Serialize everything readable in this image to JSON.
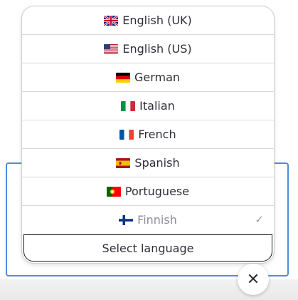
{
  "languages": [
    {
      "label": "English (UK)",
      "flag": "uk-flag-icon",
      "disabled": false,
      "checked": false
    },
    {
      "label": "English (US)",
      "flag": "us-flag-icon",
      "disabled": false,
      "checked": false
    },
    {
      "label": "German",
      "flag": "germany-flag-icon",
      "disabled": false,
      "checked": false
    },
    {
      "label": "Italian",
      "flag": "italy-flag-icon",
      "disabled": false,
      "checked": false
    },
    {
      "label": "French",
      "flag": "france-flag-icon",
      "disabled": false,
      "checked": false
    },
    {
      "label": "Spanish",
      "flag": "spain-flag-icon",
      "disabled": false,
      "checked": false
    },
    {
      "label": "Portuguese",
      "flag": "portugal-flag-icon",
      "disabled": false,
      "checked": false
    },
    {
      "label": "Finnish",
      "flag": "finland-flag-icon",
      "disabled": true,
      "checked": true
    }
  ],
  "select_label": "Select language",
  "check_glyph": "✓",
  "close_glyph": "✕",
  "colors": {
    "accent_border": "#4a8fdc",
    "text": "#2f2f3a",
    "disabled_text": "#8c8c98"
  }
}
